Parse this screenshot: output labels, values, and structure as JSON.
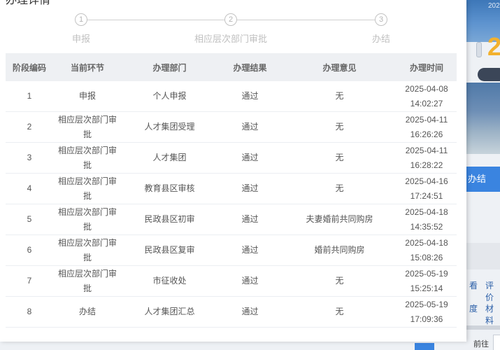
{
  "dialog": {
    "title": "办理详情"
  },
  "steps": [
    {
      "number": "1",
      "label": "申报"
    },
    {
      "number": "2",
      "label": "相应层次部门审批"
    },
    {
      "number": "3",
      "label": "办结"
    }
  ],
  "table": {
    "headers": [
      "阶段编码",
      "当前环节",
      "办理部门",
      "办理结果",
      "办理意见",
      "办理时间"
    ],
    "rows": [
      {
        "code": "1",
        "stage": "申报",
        "dept": "个人申报",
        "result": "通过",
        "opinion": "无",
        "date": "2025-04-08",
        "time": "14:02:27"
      },
      {
        "code": "2",
        "stage": "相应层次部门审批",
        "dept": "人才集团受理",
        "result": "通过",
        "opinion": "无",
        "date": "2025-04-11",
        "time": "16:26:26"
      },
      {
        "code": "3",
        "stage": "相应层次部门审批",
        "dept": "人才集团",
        "result": "通过",
        "opinion": "无",
        "date": "2025-04-11",
        "time": "16:28:22"
      },
      {
        "code": "4",
        "stage": "相应层次部门审批",
        "dept": "教育县区审核",
        "result": "通过",
        "opinion": "无",
        "date": "2025-04-16",
        "time": "17:24:51"
      },
      {
        "code": "5",
        "stage": "相应层次部门审批",
        "dept": "民政县区初审",
        "result": "通过",
        "opinion": "夫妻婚前共同购房",
        "date": "2025-04-18",
        "time": "14:35:52"
      },
      {
        "code": "6",
        "stage": "相应层次部门审批",
        "dept": "民政县区复审",
        "result": "通过",
        "opinion": "婚前共同购房",
        "date": "2025-04-18",
        "time": "15:08:26"
      },
      {
        "code": "7",
        "stage": "相应层次部门审批",
        "dept": "市征收处",
        "result": "通过",
        "opinion": "无",
        "date": "2025-05-19",
        "time": "15:25:14"
      },
      {
        "code": "8",
        "stage": "办结",
        "dept": "人才集团汇总",
        "result": "通过",
        "opinion": "无",
        "date": "2025-05-19",
        "time": "17:09:36"
      }
    ]
  },
  "background": {
    "year": "202",
    "big_digit": "2",
    "banner": "办结",
    "links": [
      "看",
      "评价",
      "度",
      "材料"
    ],
    "goto_label": "前往"
  },
  "colors": {
    "accent": "#3a84e0",
    "header_bg": "#eef0f3",
    "step_gray": "#c0c0c0"
  }
}
